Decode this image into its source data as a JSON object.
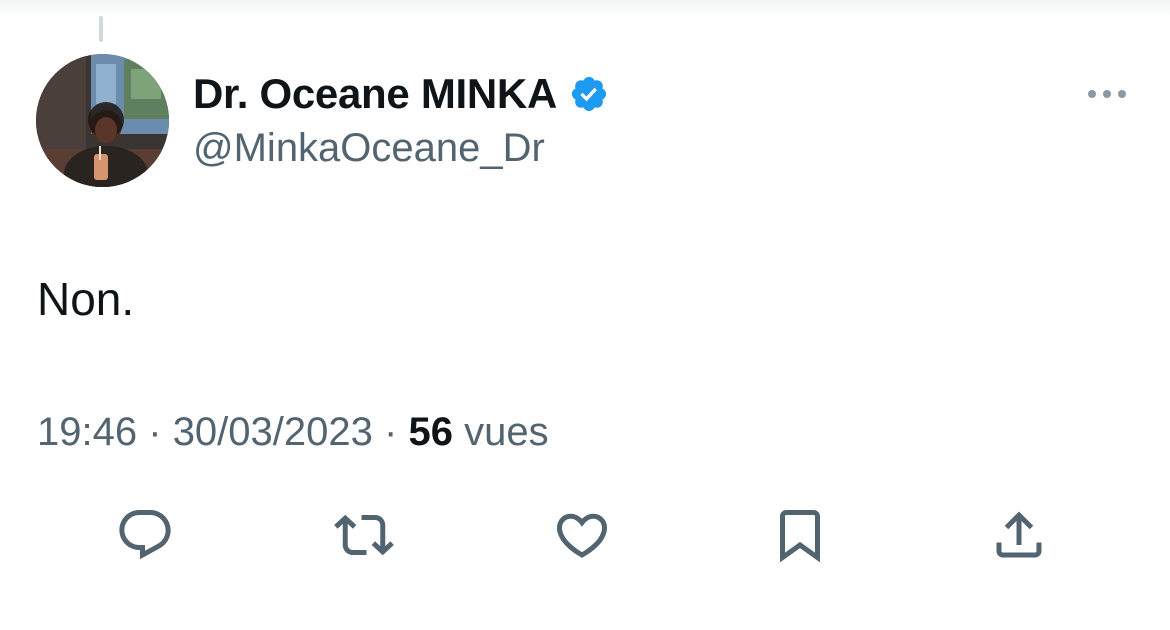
{
  "tweet": {
    "author": {
      "display_name": "Dr. Oceane MINKA",
      "handle": "@MinkaOceane_Dr",
      "verified": true,
      "verified_color": "#1d9bf0"
    },
    "text": "Non.",
    "time": "19:46",
    "separator": "·",
    "date": "30/03/2023",
    "views_count": "56",
    "views_label": "vues"
  },
  "actions": [
    {
      "name": "reply",
      "icon": "reply-icon"
    },
    {
      "name": "retweet",
      "icon": "retweet-icon"
    },
    {
      "name": "like",
      "icon": "heart-icon"
    },
    {
      "name": "bookmark",
      "icon": "bookmark-icon"
    },
    {
      "name": "share",
      "icon": "share-icon"
    }
  ],
  "colors": {
    "text_primary": "#0f1419",
    "text_secondary": "#536471",
    "thread_line": "#cfd9de"
  }
}
